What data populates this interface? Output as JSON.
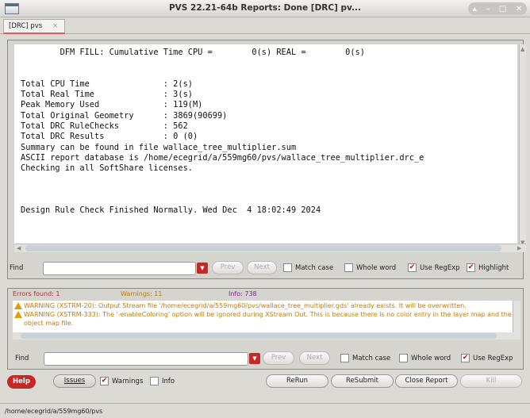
{
  "window": {
    "title": "PVS 22.21-64b  Reports: Done [DRC] pv..."
  },
  "tabs": [
    {
      "label": "[DRC] pvs",
      "close": "×"
    }
  ],
  "log": {
    "lines": [
      "        DFM FILL: Cumulative Time CPU =        0(s) REAL =        0(s)",
      "",
      "",
      "Total CPU Time               : 2(s)",
      "Total Real Time              : 3(s)",
      "Peak Memory Used             : 119(M)",
      "Total Original Geometry      : 3869(90699)",
      "Total DRC RuleChecks         : 562",
      "Total DRC Results            : 0 (0)",
      "Summary can be found in file wallace_tree_multiplier.sum",
      "ASCII report database is /home/ecegrid/a/559mg60/pvs/wallace_tree_multiplier.drc_e",
      "Checking in all SoftShare licenses.",
      "",
      "",
      "",
      "Design Rule Check Finished Normally. Wed Dec  4 18:02:49 2024"
    ]
  },
  "find1": {
    "label": "Find",
    "value": "",
    "prev": "Prev",
    "next": "Next",
    "match_case": "Match case",
    "whole_word": "Whole word",
    "use_regexp": "Use RegExp",
    "highlight": "Highlight",
    "match_case_checked": false,
    "whole_word_checked": false,
    "use_regexp_checked": true,
    "highlight_checked": true
  },
  "messages": {
    "errors": "Errors found: 1",
    "warnings": "Warnings: 11",
    "info": "Info: 738",
    "items": [
      "WARNING (XSTRM-20): Output Stream file '/home/ecegrid/a/559mg60/pvs/wallace_tree_multiplier.gds' already exists. It will be overwritten.",
      "WARNING (XSTRM-333): The '-enableColoring' option will be ignored during XStream Out. This is because there is no color entry in the layer map and the object map file."
    ]
  },
  "find2": {
    "label": "Find",
    "value": "",
    "prev": "Prev",
    "next": "Next",
    "match_case": "Match case",
    "whole_word": "Whole word",
    "use_regexp": "Use RegExp",
    "use_regexp_checked": true
  },
  "bottom": {
    "help": "Help",
    "issues": "Issues",
    "warnings": "Warnings",
    "warnings_checked": true,
    "info": "Info",
    "info_checked": false,
    "rerun": "ReRun",
    "resubmit": "ReSubmit",
    "close_report": "Close Report",
    "kill": "Kill"
  },
  "status": {
    "path": "/home/ecegrid/a/559mg60/pvs"
  },
  "colors": {
    "accent": "#c62828",
    "warning": "#c57a00",
    "info": "#7b1fa2"
  }
}
